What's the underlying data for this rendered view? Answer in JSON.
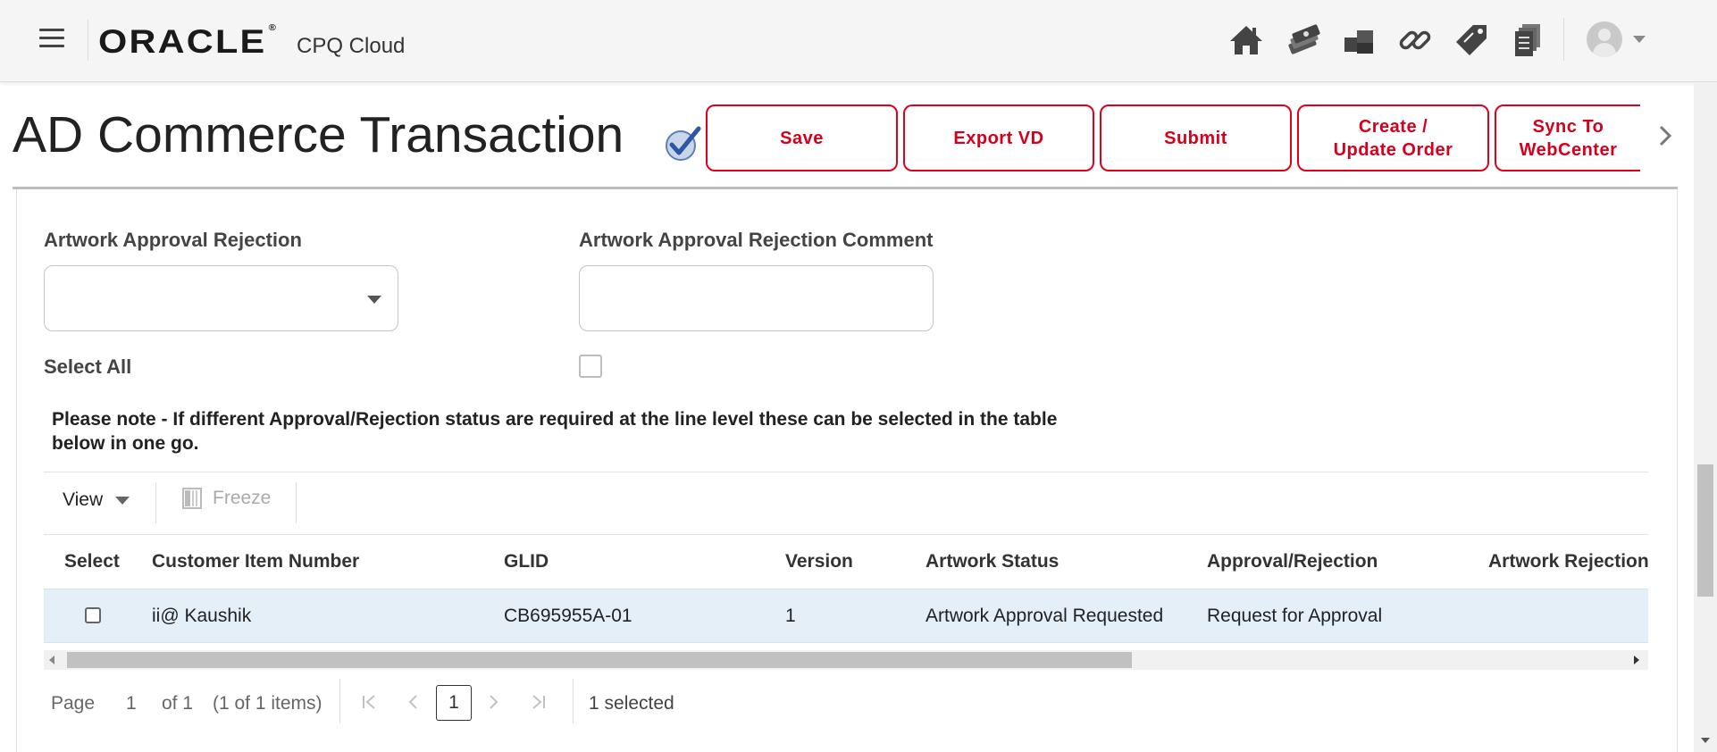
{
  "header": {
    "logo_text": "ORACLE",
    "logo_mark": "®",
    "product_name": "CPQ Cloud",
    "icons": [
      "home-icon",
      "quotes-icon",
      "documents-icon",
      "link-icon",
      "tag-icon",
      "pages-icon"
    ],
    "user_menu_icon": "user-avatar-icon"
  },
  "title": {
    "text": "AD Commerce Transaction",
    "status_icon": "verified-check-icon"
  },
  "actions": [
    {
      "label": "Save"
    },
    {
      "label": "Export VD"
    },
    {
      "label": "Submit"
    },
    {
      "label": "Create /\nUpdate Order"
    },
    {
      "label": "Sync To\nWebCenter"
    }
  ],
  "form": {
    "rejection_label": "Artwork Approval Rejection",
    "rejection_value": "",
    "comment_label": "Artwork Approval Rejection Comment",
    "comment_value": "",
    "select_all_label": "Select All",
    "select_all_checked": false,
    "note": "Please note - If different Approval/Rejection status are required at the line level these can be selected in the table below in one go."
  },
  "toolbar": {
    "view_label": "View",
    "freeze_label": "Freeze"
  },
  "table": {
    "columns": [
      "Select",
      "Customer Item Number",
      "GLID",
      "Version",
      "Artwork Status",
      "Approval/Rejection",
      "Artwork Rejection"
    ],
    "rows": [
      {
        "selected": false,
        "customer_item_number": "ii@ Kaushik",
        "glid": "CB695955A-01",
        "version": "1",
        "artwork_status": "Artwork Approval Requested",
        "approval_rejection": "Request for Approval",
        "artwork_rejection": ""
      }
    ]
  },
  "pagination": {
    "page_label": "Page",
    "page_current": "1",
    "page_of": "of 1",
    "items_summary": "(1 of 1 items)",
    "page_box": "1",
    "selected_text": "1 selected"
  },
  "colors": {
    "accent_red": "#d6001c",
    "row_highlight": "#e4eff7"
  }
}
